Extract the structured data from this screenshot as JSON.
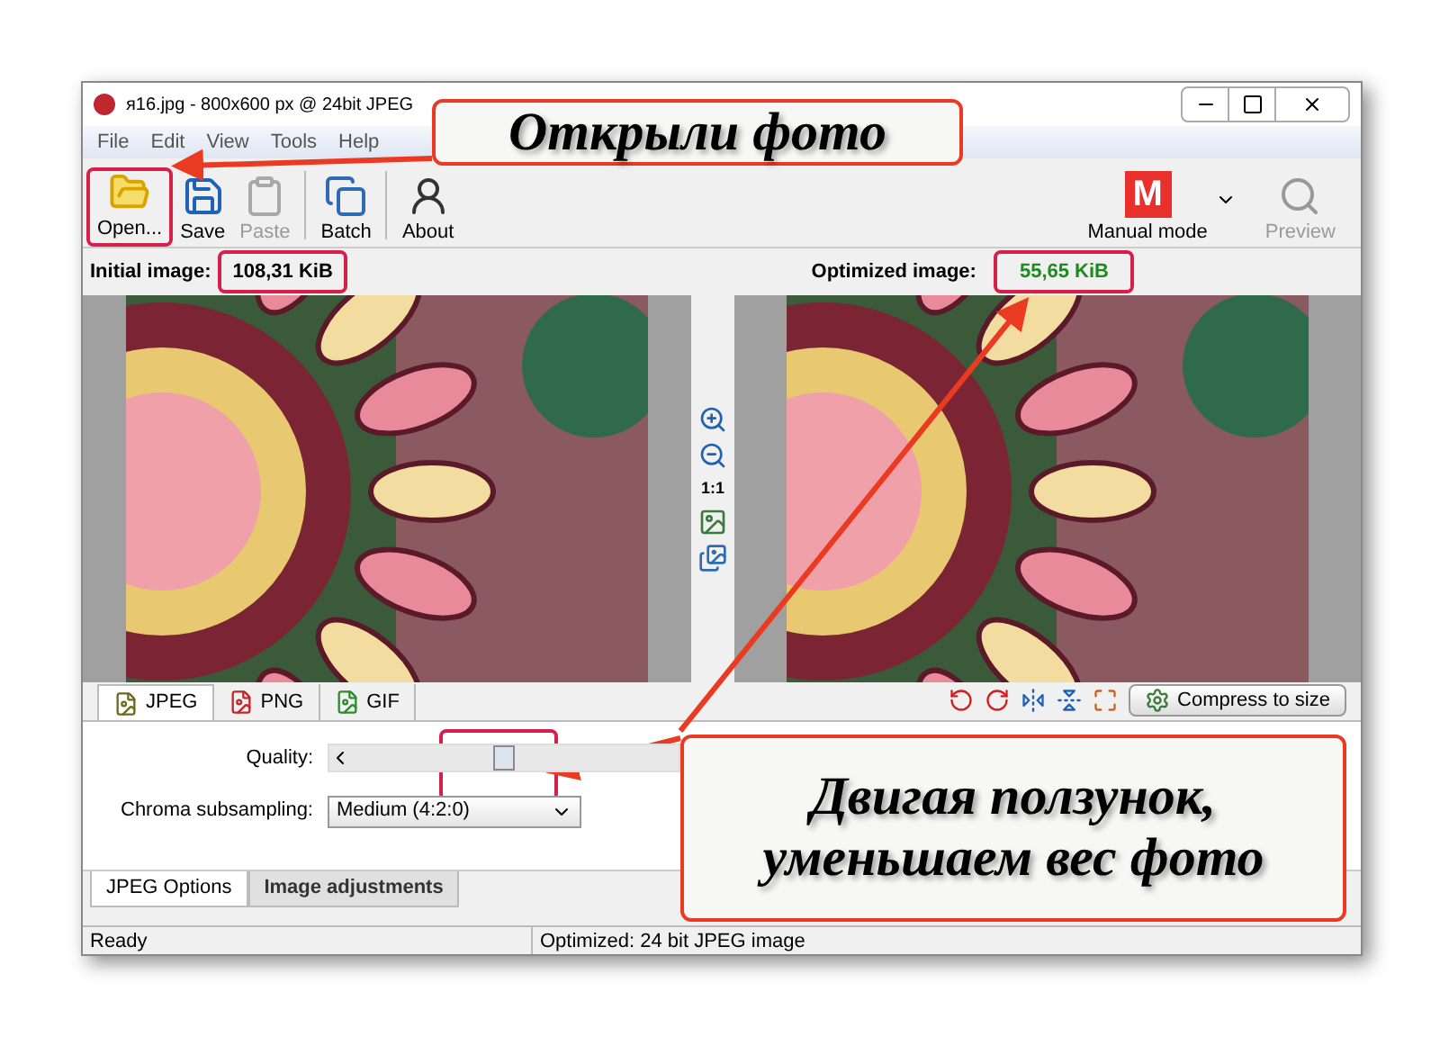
{
  "window": {
    "title": "я16.jpg - 800x600 px @ 24bit JPEG"
  },
  "menu": [
    "File",
    "Edit",
    "View",
    "Tools",
    "Help"
  ],
  "toolbar": [
    {
      "kind": "open",
      "label": "Open...",
      "disabled": false
    },
    {
      "kind": "save",
      "label": "Save",
      "disabled": false
    },
    {
      "kind": "paste",
      "label": "Paste",
      "disabled": true
    },
    {
      "kind": "batch",
      "label": "Batch",
      "disabled": false
    },
    {
      "kind": "about",
      "label": "About",
      "disabled": false
    }
  ],
  "mode": {
    "badge": "M",
    "label": "Manual mode"
  },
  "preview": {
    "label": "Preview",
    "disabled": true
  },
  "initial": {
    "label": "Initial image:",
    "size": "108,31 KiB"
  },
  "optimized": {
    "label": "Optimized image:",
    "size": "55,65 KiB"
  },
  "zoom_tools": {
    "one_to_one": "1:1"
  },
  "format_tabs": [
    {
      "label": "JPEG",
      "selected": true,
      "color": "#6b6b1e"
    },
    {
      "label": "PNG",
      "selected": false,
      "color": "#c0282d"
    },
    {
      "label": "GIF",
      "selected": false,
      "color": "#2e8b2e"
    }
  ],
  "compress_button": "Compress to size",
  "quality": {
    "label": "Quality:",
    "level": 0.5
  },
  "chroma": {
    "label": "Chroma subsampling:",
    "value": "Medium (4:2:0)"
  },
  "option_tabs": [
    {
      "label": "JPEG Options",
      "selected": true
    },
    {
      "label": "Image adjustments",
      "selected": false
    }
  ],
  "status_bar": [
    "Ready",
    "Optimized: 24 bit JPEG image"
  ],
  "annotations": [
    "Открыли фото",
    "Двигая ползунок, уменьшаем вес фото"
  ]
}
